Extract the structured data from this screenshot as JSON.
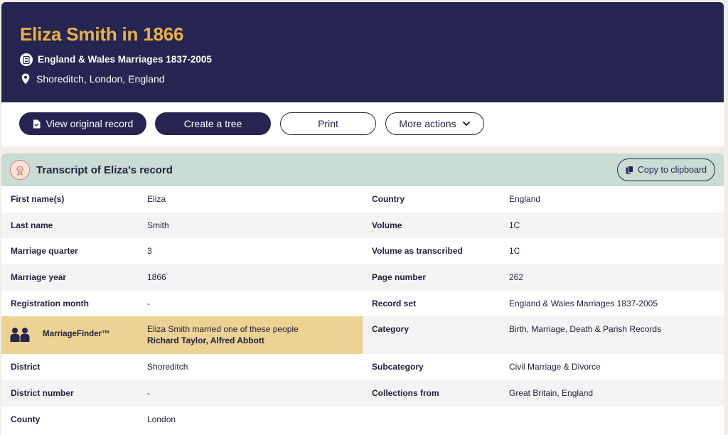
{
  "header": {
    "title": "Eliza Smith in 1866",
    "collection": "England & Wales Marriages 1837-2005",
    "location": "Shoreditch, London, England"
  },
  "actions": {
    "view_original": "View original record",
    "create_tree": "Create a tree",
    "print": "Print",
    "more_actions": "More actions"
  },
  "transcript": {
    "title": "Transcript of Eliza's record",
    "copy_label": "Copy to clipboard"
  },
  "left_fields": [
    {
      "label": "First name(s)",
      "value": "Eliza"
    },
    {
      "label": "Last name",
      "value": "Smith"
    },
    {
      "label": "Marriage quarter",
      "value": "3"
    },
    {
      "label": "Marriage year",
      "value": "1866"
    },
    {
      "label": "Registration month",
      "value": "-"
    },
    {
      "label": "District",
      "value": "Shoreditch"
    },
    {
      "label": "District number",
      "value": "-"
    },
    {
      "label": "County",
      "value": "London"
    }
  ],
  "marriage_finder": {
    "label": "MarriageFinder™",
    "text": "Eliza Smith married one of these people",
    "names": "Richard Taylor, Alfred Abbott"
  },
  "right_fields": [
    {
      "label": "Country",
      "value": "England"
    },
    {
      "label": "Volume",
      "value": "1C"
    },
    {
      "label": "Volume as transcribed",
      "value": "1C"
    },
    {
      "label": "Page number",
      "value": "262"
    },
    {
      "label": "Record set",
      "value": "England & Wales Marriages 1837-2005"
    },
    {
      "label": "Category",
      "value": "Birth, Marriage, Death & Parish Records"
    },
    {
      "label": "Subcategory",
      "value": "Civil Marriage & Divorce"
    },
    {
      "label": "Collections from",
      "value": "Great Britain, England"
    }
  ],
  "colors": {
    "navy": "#262450",
    "gold_title": "#e9b146",
    "mint_header": "#c9ddd5",
    "marriage_finder_bg": "#ecd293"
  },
  "icons": {
    "collection": "document-icon",
    "location": "map-pin-icon",
    "view_original": "file-icon",
    "more_actions": "chevron-down-icon",
    "transcript": "seal-icon",
    "copy": "copy-icon",
    "marriage_finder": "people-icon"
  }
}
